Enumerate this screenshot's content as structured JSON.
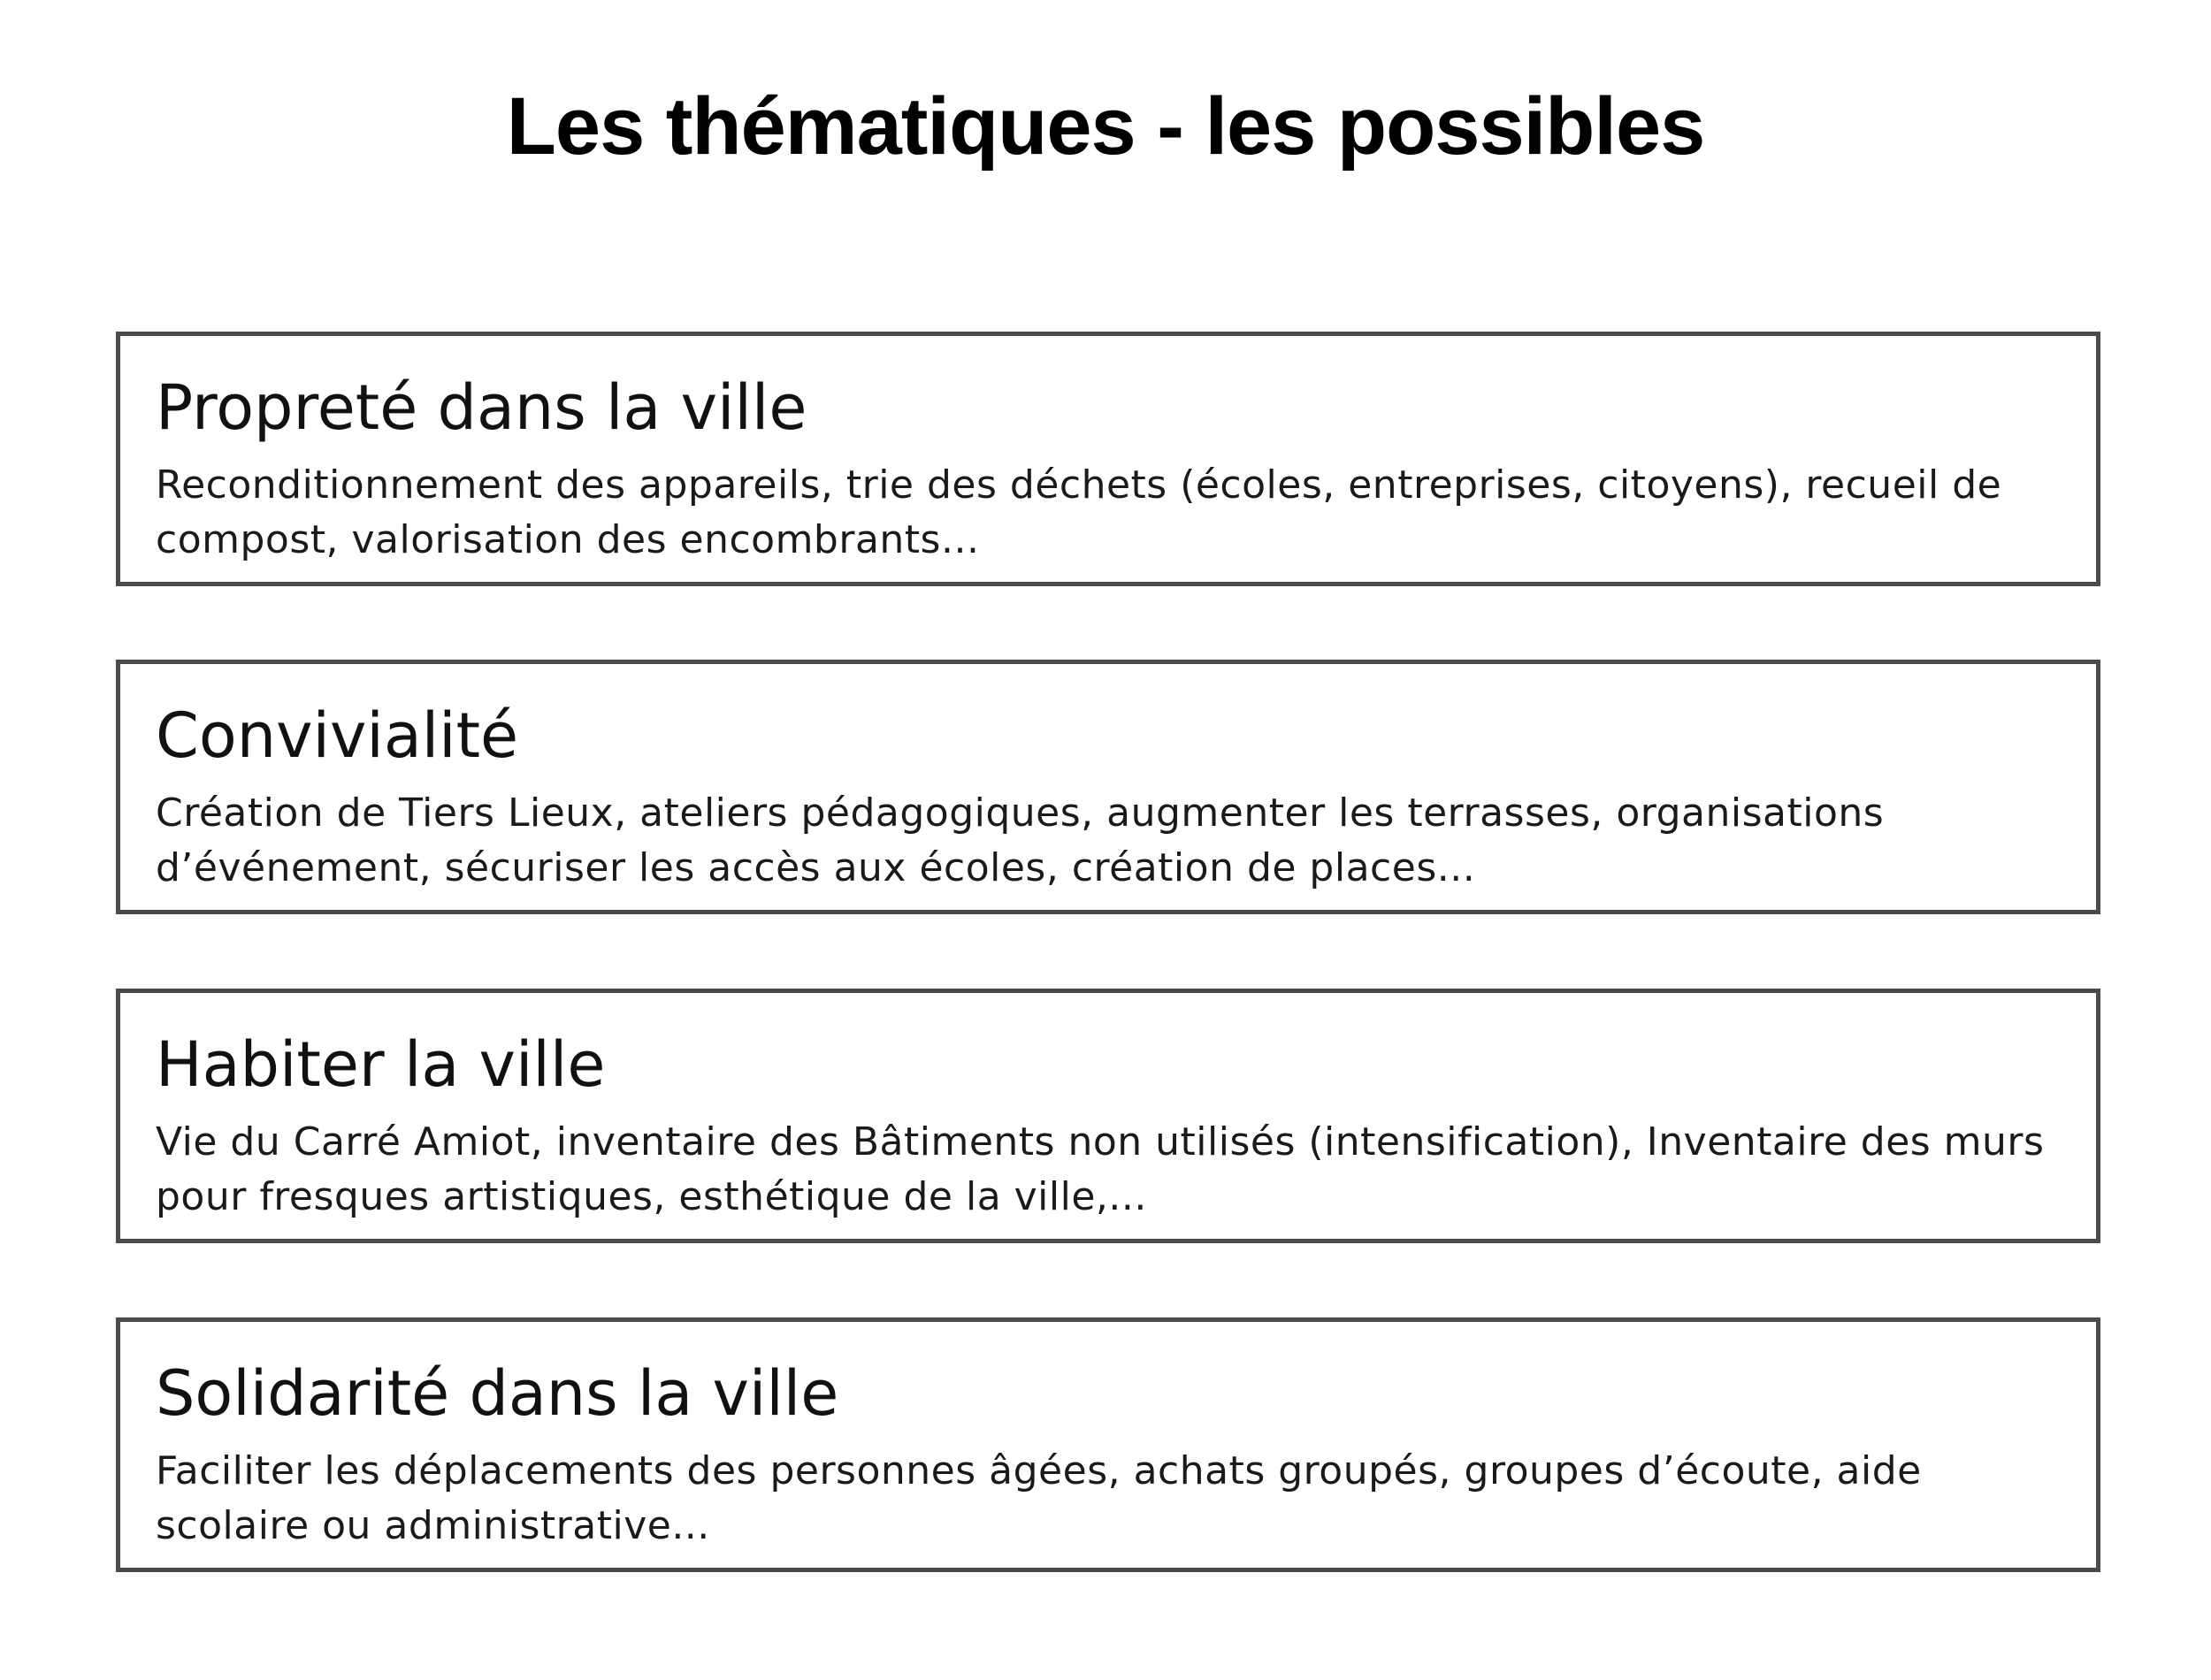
{
  "title": "Les thématiques - les possibles",
  "themes": [
    {
      "heading": "Propreté dans la ville",
      "description": "Reconditionnement des appareils, trie des déchets (écoles, entreprises, citoyens), recueil de compost, valorisation des encombrants..."
    },
    {
      "heading": "Convivialité",
      "description": "Création de Tiers Lieux, ateliers pédagogiques, augmenter les terrasses, organisations d’événement, sécuriser les accès aux écoles, création de places..."
    },
    {
      "heading": "Habiter la ville",
      "description": "Vie du Carré Amiot, inventaire des Bâtiments non utilisés (intensification), Inventaire des murs pour fresques artistiques, esthétique de la ville,..."
    },
    {
      "heading": "Solidarité dans la ville",
      "description": "Faciliter les déplacements des personnes âgées, achats groupés, groupes d’écoute, aide scolaire ou administrative..."
    }
  ]
}
